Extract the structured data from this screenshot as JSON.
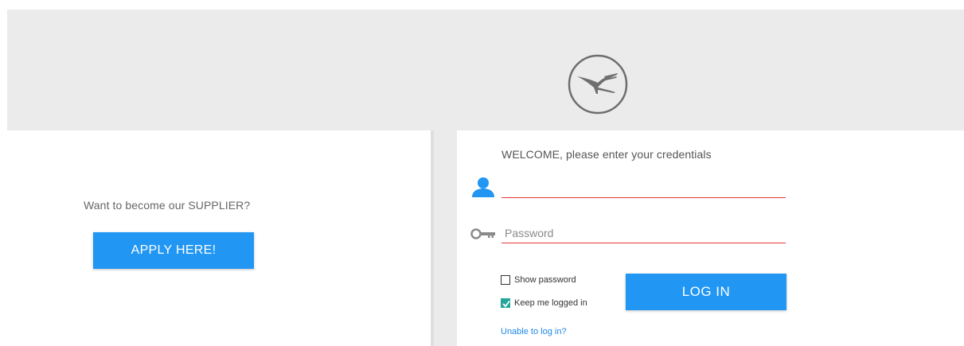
{
  "header": {
    "logo_icon": "crane-logo-icon"
  },
  "supplier": {
    "prompt": "Want to become our SUPPLIER?",
    "apply_label": "APPLY HERE!"
  },
  "login": {
    "welcome": "WELCOME, please enter your credentials",
    "username": {
      "icon": "user-icon",
      "value": "",
      "placeholder": ""
    },
    "password": {
      "icon": "key-icon",
      "value": "",
      "placeholder": "Password"
    },
    "show_password": {
      "label": "Show password",
      "checked": false
    },
    "keep_logged_in": {
      "label": "Keep me logged in",
      "checked": true
    },
    "login_label": "LOG IN",
    "unable_link": "Unable to log in?"
  },
  "colors": {
    "accent": "#2196f3",
    "error_underline": "#e53935",
    "checkbox_checked": "#26a69a",
    "link": "#1e88e5",
    "header_bg": "#ebebeb"
  }
}
